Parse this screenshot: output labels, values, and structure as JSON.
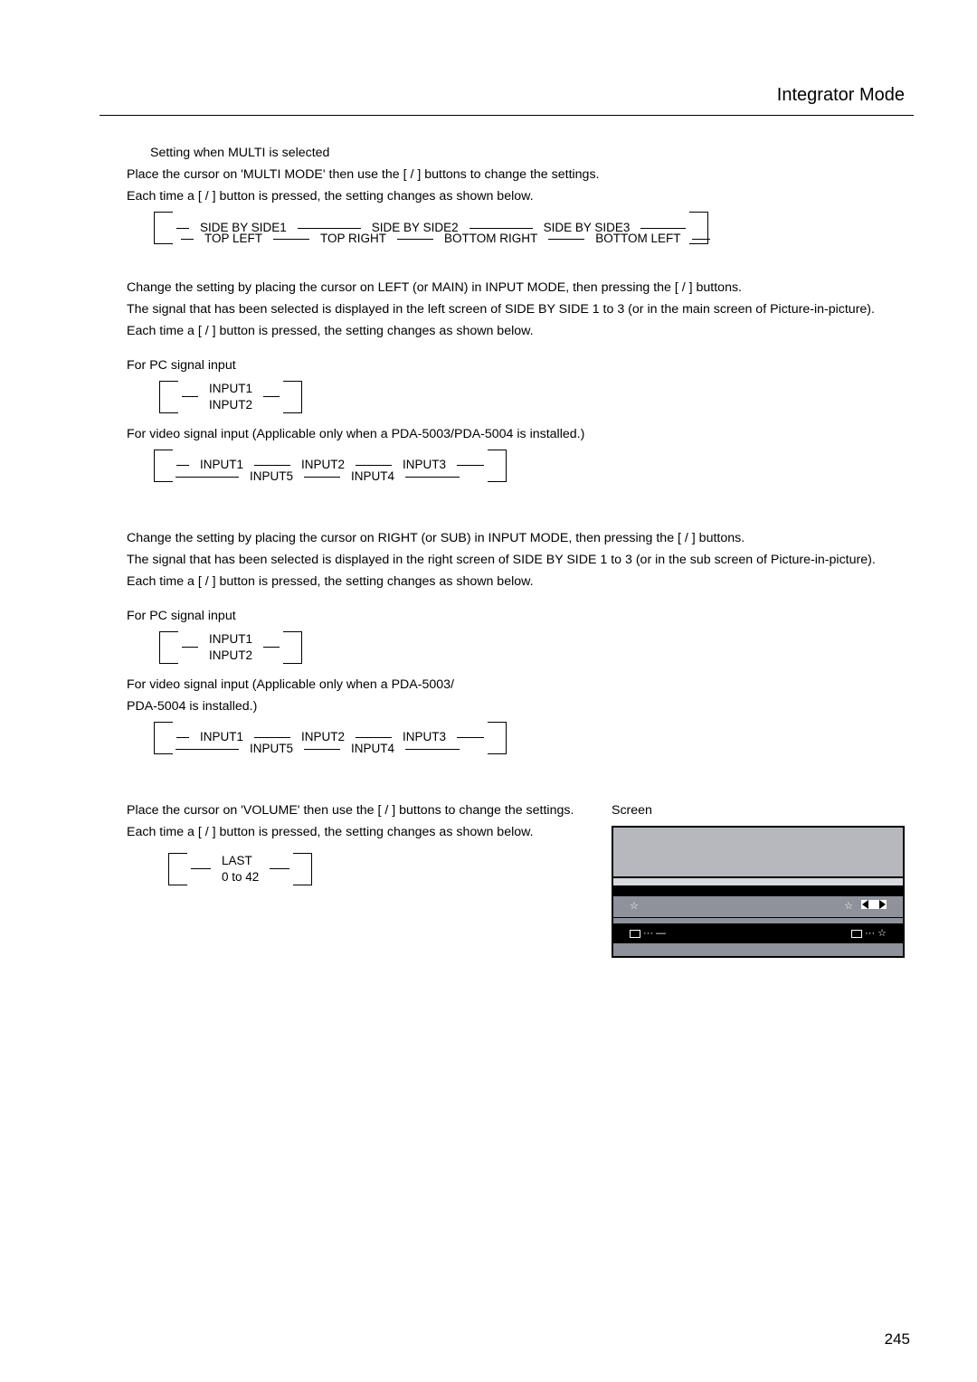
{
  "header": {
    "title": "Integrator Mode"
  },
  "section_multi": {
    "heading": "Setting when MULTI is selected",
    "line1": "Place the cursor on 'MULTI MODE' then use the [   /   ] buttons to change the settings.",
    "line2": "Each time a [   /   ] button is pressed, the setting changes as shown below.",
    "cycle_top": [
      "SIDE BY SIDE1",
      "SIDE BY SIDE2",
      "SIDE BY SIDE3"
    ],
    "cycle_bottom": [
      "TOP LEFT",
      "TOP RIGHT",
      "BOTTOM RIGHT",
      "BOTTOM LEFT"
    ]
  },
  "section_left": {
    "p1": "Change the setting by placing the cursor on LEFT (or MAIN) in INPUT MODE, then pressing the [   /   ] buttons.",
    "p2": "The signal that has been selected is displayed in the left screen of SIDE BY SIDE 1 to 3 (or in the main screen of Picture-in-picture).",
    "p3": "Each time a [   /   ] button is pressed, the setting changes as shown below.",
    "pc_label": "For PC signal input",
    "pc_cycle": [
      "INPUT1",
      "INPUT2"
    ],
    "video_label": "For video signal input (Applicable only when a PDA-5003/PDA-5004 is installed.)",
    "video_top": [
      "INPUT1",
      "INPUT2",
      "INPUT3"
    ],
    "video_bottom": [
      "INPUT5",
      "INPUT4"
    ]
  },
  "section_right": {
    "p1": "Change the setting by placing the cursor on RIGHT (or SUB) in INPUT MODE, then pressing the [   /   ] buttons.",
    "p2": "The signal that has been selected is displayed in the right screen of SIDE BY SIDE 1 to 3 (or in the sub screen of Picture-in-picture).",
    "p3": "Each time a [   /   ] button is pressed, the setting changes as shown below.",
    "pc_label": "For PC signal input",
    "pc_cycle": [
      "INPUT1",
      "INPUT2"
    ],
    "video_label1": "For video signal input (Applicable only when a PDA-5003/",
    "video_label2": "PDA-5004 is installed.)",
    "video_top": [
      "INPUT1",
      "INPUT2",
      "INPUT3"
    ],
    "video_bottom": [
      "INPUT5",
      "INPUT4"
    ]
  },
  "section_volume": {
    "p1": "Place the cursor on 'VOLUME' then use the [   /   ] buttons to change the settings.",
    "p2": "Each time a [   /   ] button is pressed, the setting changes as shown below.",
    "cycle": [
      "LAST",
      "0 to 42"
    ]
  },
  "screen": {
    "label": "Screen",
    "star": "☆",
    "dots": "···",
    "dash": "—"
  },
  "page_number": "245"
}
